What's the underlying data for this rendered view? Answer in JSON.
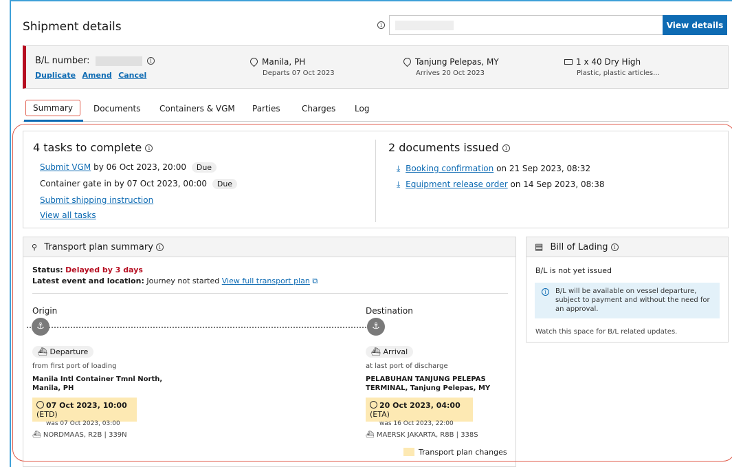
{
  "header": {
    "title": "Shipment details",
    "view_button": "View details"
  },
  "bl": {
    "label": "B/L number:",
    "actions": [
      "Duplicate",
      "Amend",
      "Cancel"
    ],
    "origin": {
      "city": "Manila, PH",
      "sub": "Departs 07 Oct 2023"
    },
    "destination": {
      "city": "Tanjung Pelepas, MY",
      "sub": "Arrives 20 Oct 2023"
    },
    "container": {
      "title": "1 x 40 Dry High",
      "sub": "Plastic, plastic articles..."
    }
  },
  "tabs": [
    "Summary",
    "Documents",
    "Containers & VGM",
    "Parties",
    "Charges",
    "Log"
  ],
  "tasks": {
    "title": "4 tasks to complete",
    "task1_link": "Submit VGM",
    "task1_rest": "by 06 Oct 2023, 20:00",
    "task2": "Container gate in by 07 Oct 2023, 00:00",
    "due": "Due",
    "task3_link": "Submit shipping instruction",
    "view_all": "View all tasks"
  },
  "documents": {
    "title": "2 documents issued",
    "doc1_link": "Booking confirmation",
    "doc1_date": "on 21 Sep 2023, 08:32",
    "doc2_link": "Equipment release order",
    "doc2_date": "on 14 Sep 2023, 08:38"
  },
  "transport": {
    "title": "Transport plan summary",
    "status_label": "Status:",
    "status_value": "Delayed by 3 days",
    "event_label": "Latest event and location:",
    "event_value": "Journey not started",
    "full_plan_link": "View full transport plan",
    "origin_label": "Origin",
    "destination_label": "Destination",
    "departure_pill": "Departure",
    "departure_sub": "from first port of loading",
    "origin_terminal_1": "Manila Intl Container Tmnl North,",
    "origin_terminal_2": "Manila, PH",
    "etd_bold": "07 Oct 2023, 10:00",
    "etd_tag": "(ETD)",
    "etd_was": "was 07 Oct 2023, 03:00",
    "origin_vessel": "NORDMAAS, R2B | 339N",
    "arrival_pill": "Arrival",
    "arrival_sub": "at last port of discharge",
    "dest_terminal_1": "PELABUHAN TANJUNG PELEPAS",
    "dest_terminal_2": "TERMINAL, Tanjung Pelepas, MY",
    "eta_bold": "20 Oct 2023, 04:00",
    "eta_tag": "(ETA)",
    "eta_was": "was 16 Oct 2023, 22:00",
    "dest_vessel": "MAERSK JAKARTA, R8B | 338S",
    "legend": "Transport plan changes"
  },
  "bol": {
    "title": "Bill of Lading",
    "status": "B/L is not yet issued",
    "note": "B/L will be available on vessel departure, subject to payment and without the need for an approval.",
    "watch": "Watch this space for B/L related updates."
  },
  "colors": {
    "brand_blue": "#0e6bb3",
    "alert_red": "#b60e21",
    "highlight": "#fde9b3"
  }
}
